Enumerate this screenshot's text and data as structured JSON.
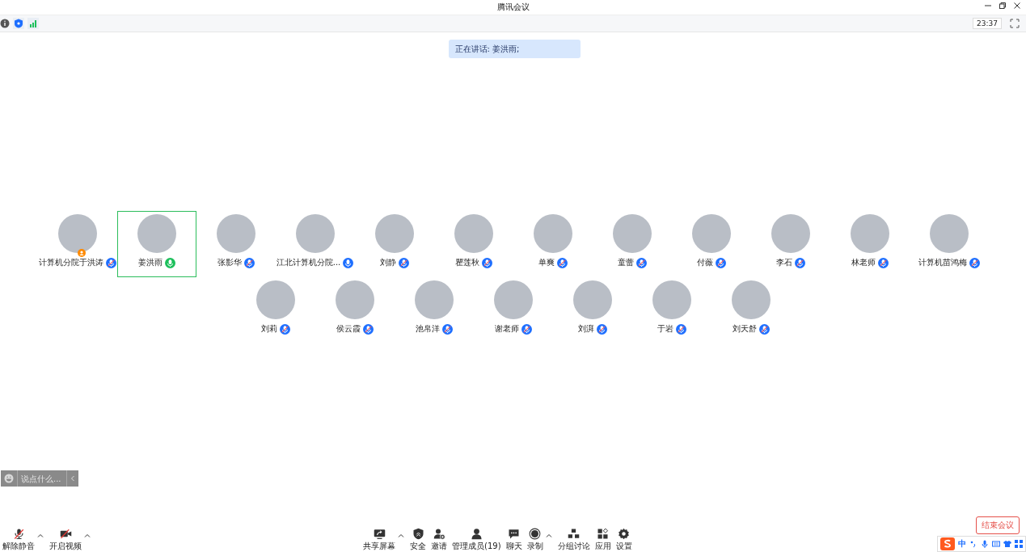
{
  "window": {
    "title": "腾讯会议"
  },
  "status_bar": {
    "time": "23:37"
  },
  "speaking_banner": "正在讲话: 姜洪雨;",
  "participants": [
    {
      "name": "计算机分院于洪涛",
      "muted": true,
      "speaking": false,
      "host": true,
      "selected": false
    },
    {
      "name": "姜洪雨",
      "muted": false,
      "speaking": true,
      "host": false,
      "selected": true
    },
    {
      "name": "张影华",
      "muted": true,
      "speaking": false,
      "host": false,
      "selected": false
    },
    {
      "name": "江北计算机分院...",
      "muted": false,
      "speaking": false,
      "host": false,
      "selected": false
    },
    {
      "name": "刘静",
      "muted": true,
      "speaking": false,
      "host": false,
      "selected": false
    },
    {
      "name": "瞿莲秋",
      "muted": true,
      "speaking": false,
      "host": false,
      "selected": false
    },
    {
      "name": "单爽",
      "muted": true,
      "speaking": false,
      "host": false,
      "selected": false
    },
    {
      "name": "童蕾",
      "muted": true,
      "speaking": false,
      "host": false,
      "selected": false
    },
    {
      "name": "付薇",
      "muted": true,
      "speaking": false,
      "host": false,
      "selected": false
    },
    {
      "name": "李石",
      "muted": true,
      "speaking": false,
      "host": false,
      "selected": false
    },
    {
      "name": "林老师",
      "muted": true,
      "speaking": false,
      "host": false,
      "selected": false
    },
    {
      "name": "计算机苗鸿梅",
      "muted": true,
      "speaking": false,
      "host": false,
      "selected": false
    },
    {
      "name": "刘莉",
      "muted": true,
      "speaking": false,
      "host": false,
      "selected": false
    },
    {
      "name": "侯云霞",
      "muted": true,
      "speaking": false,
      "host": false,
      "selected": false
    },
    {
      "name": "池帛洋",
      "muted": true,
      "speaking": false,
      "host": false,
      "selected": false
    },
    {
      "name": "谢老师",
      "muted": true,
      "speaking": false,
      "host": false,
      "selected": false
    },
    {
      "name": "刘湃",
      "muted": true,
      "speaking": false,
      "host": false,
      "selected": false
    },
    {
      "name": "于岩",
      "muted": true,
      "speaking": false,
      "host": false,
      "selected": false
    },
    {
      "name": "刘天舒",
      "muted": true,
      "speaking": false,
      "host": false,
      "selected": false
    }
  ],
  "chat_input": {
    "placeholder": "说点什么..."
  },
  "toolbar_left": [
    {
      "kind": "mic-off",
      "label": "解除静音",
      "caret": true
    },
    {
      "kind": "video-off",
      "label": "开启视频",
      "caret": true
    }
  ],
  "toolbar_center": [
    {
      "kind": "share",
      "label": "共享屏幕",
      "caret": true
    },
    {
      "kind": "shield",
      "label": "安全",
      "caret": false
    },
    {
      "kind": "invite",
      "label": "邀请",
      "caret": false
    },
    {
      "kind": "members",
      "label": "管理成员(19)",
      "caret": false
    },
    {
      "kind": "chat",
      "label": "聊天",
      "caret": false
    },
    {
      "kind": "record",
      "label": "录制",
      "caret": true
    },
    {
      "kind": "breakout",
      "label": "分组讨论",
      "caret": false
    },
    {
      "kind": "apps",
      "label": "应用",
      "caret": false
    },
    {
      "kind": "settings",
      "label": "设置",
      "caret": false
    }
  ],
  "end_button": "结束会议",
  "ime_bar": {
    "mode": "中"
  }
}
